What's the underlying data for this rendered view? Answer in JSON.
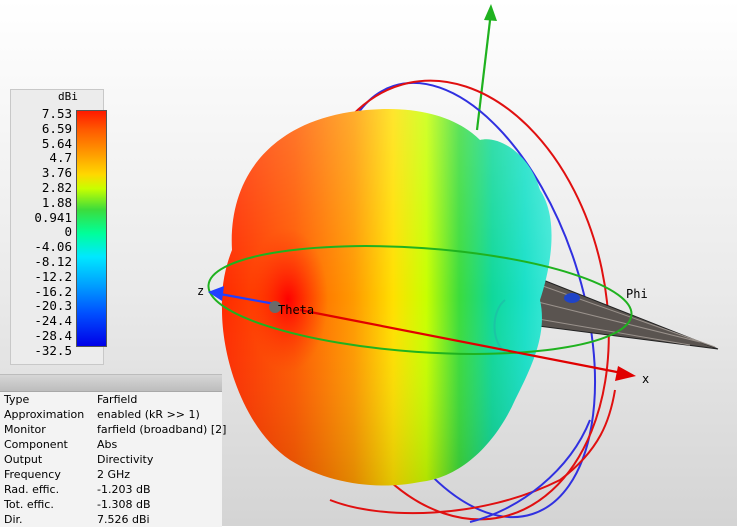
{
  "legend": {
    "unit": "dBi",
    "ticks": [
      "7.53",
      "6.59",
      "5.64",
      "4.7",
      "3.76",
      "2.82",
      "1.88",
      "0.941",
      "0",
      "-4.06",
      "-8.12",
      "-12.2",
      "-16.2",
      "-20.3",
      "-24.4",
      "-28.4",
      "-32.5"
    ]
  },
  "info": {
    "rows": [
      {
        "key": "Type",
        "value": "Farfield"
      },
      {
        "key": "Approximation",
        "value": "enabled (kR >> 1)"
      },
      {
        "key": "Monitor",
        "value": "farfield (broadband) [2]"
      },
      {
        "key": "Component",
        "value": "Abs"
      },
      {
        "key": "Output",
        "value": "Directivity"
      },
      {
        "key": "Frequency",
        "value": "2 GHz"
      },
      {
        "key": "Rad. effic.",
        "value": "-1.203 dB"
      },
      {
        "key": "Tot. effic.",
        "value": "-1.308 dB"
      },
      {
        "key": "Dir.",
        "value": "7.526 dBi"
      }
    ]
  },
  "scene": {
    "labels": {
      "z": "z",
      "x": "x",
      "theta": "Theta",
      "phi": "Phi"
    }
  },
  "colors": {
    "scale": [
      "#ff0000",
      "#ff6a00",
      "#ffcc00",
      "#d8ff00",
      "#00ff00",
      "#00ffb0",
      "#00e0ff",
      "#0060ff",
      "#0000ff"
    ],
    "axis_x": "#e00000",
    "axis_y": "#00b000",
    "axis_z": "#2040ff"
  }
}
